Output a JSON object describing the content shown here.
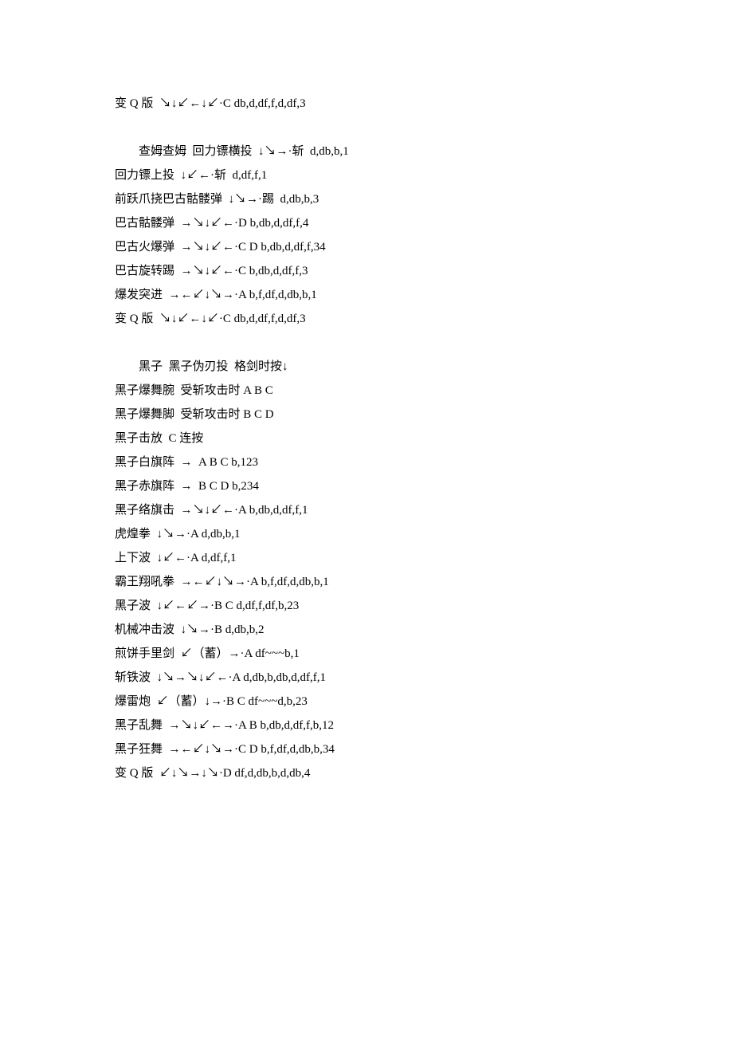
{
  "sections": [
    {
      "lines": [
        "变 Q 版  ↘↓↙←↓↙·C db,d,df,f,d,df,3"
      ]
    },
    {
      "header": "　　查姆查姆  回力镖横投  ↓↘→·斩  d,db,b,1",
      "lines": [
        "回力镖上投  ↓↙←·斩  d,df,f,1",
        "前跃爪挠巴古骷髅弹  ↓↘→·踢  d,db,b,3",
        "巴古骷髅弹  →↘↓↙←·D b,db,d,df,f,4",
        "巴古火爆弹  →↘↓↙←·C D b,db,d,df,f,34",
        "巴古旋转踢  →↘↓↙←·C b,db,d,df,f,3",
        "爆发突进  →←↙↓↘→·A b,f,df,d,db,b,1",
        "变 Q 版  ↘↓↙←↓↙·C db,d,df,f,d,df,3"
      ]
    },
    {
      "header": "　　黑子  黑子伪刃投  格剑时按↓",
      "lines": [
        "黑子爆舞腕  受斩攻击时 A B C",
        "黑子爆舞脚  受斩攻击时 B C D",
        "黑子击放  C 连按",
        "黑子白旗阵  →  A B C b,123",
        "黑子赤旗阵  →  B C D b,234",
        "黑子络旗击  →↘↓↙←·A b,db,d,df,f,1",
        "虎煌拳  ↓↘→·A d,db,b,1",
        "上下波  ↓↙←·A d,df,f,1",
        "霸王翔吼拳  →←↙↓↘→·A b,f,df,d,db,b,1",
        "黑子波  ↓↙←↙→·B C d,df,f,df,b,23",
        "机械冲击波  ↓↘→·B d,db,b,2",
        "煎饼手里剑  ↙（蓄）→·A df~~~b,1",
        "斩铁波  ↓↘→↘↓↙←·A d,db,b,db,d,df,f,1",
        "爆雷炮  ↙（蓄）↓→·B C df~~~d,b,23",
        "黑子乱舞  →↘↓↙←→·A B b,db,d,df,f,b,12",
        "黑子狂舞  →←↙↓↘→·C D b,f,df,d,db,b,34",
        "变 Q 版  ↙↓↘→↓↘·D df,d,db,b,d,db,4"
      ]
    }
  ]
}
